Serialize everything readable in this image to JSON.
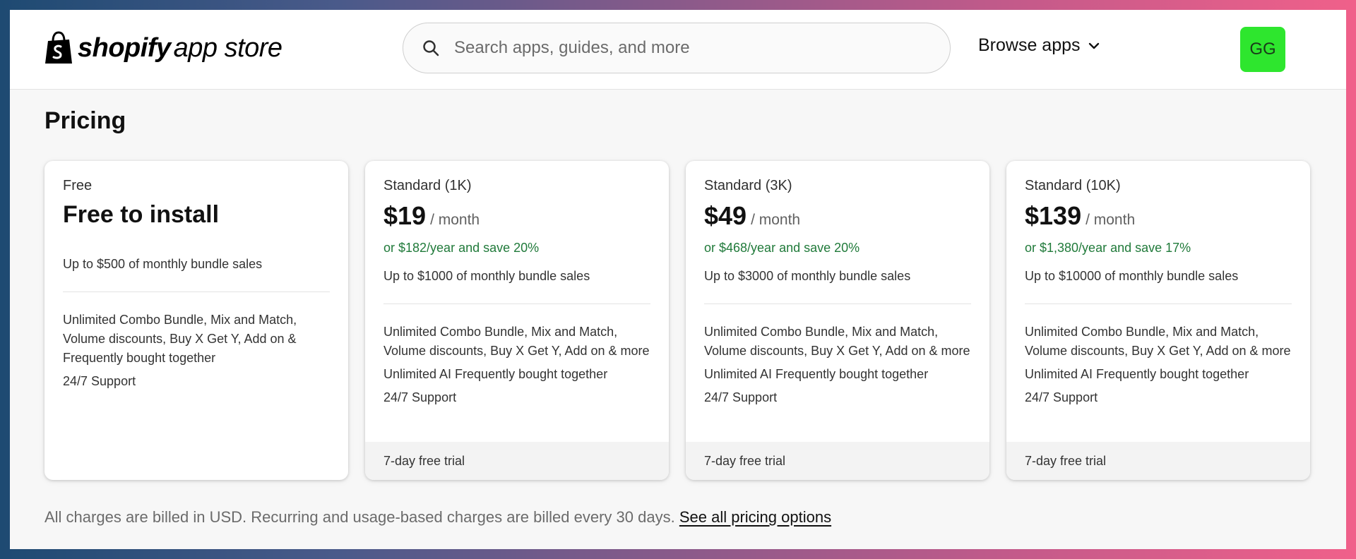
{
  "header": {
    "logo": {
      "bold": "shopify",
      "light": "app store"
    },
    "search": {
      "placeholder": "Search apps, guides, and more",
      "icon": "search-icon"
    },
    "browse_label": "Browse apps",
    "avatar_initials": "GG"
  },
  "colors": {
    "accent_green": "#207a3a",
    "avatar_bg": "#2ee62e"
  },
  "pricing": {
    "title": "Pricing",
    "plans": [
      {
        "name": "Free",
        "headline": "Free to install",
        "limit": "Up to $500 of monthly bundle sales",
        "features": [
          "Unlimited Combo Bundle, Mix and Match, Volume discounts, Buy X Get Y, Add on & Frequently bought together",
          "24/7 Support"
        ]
      },
      {
        "name": "Standard (1K)",
        "price": "$19",
        "period": "/ month",
        "annual": "or $182/year and save 20%",
        "limit": "Up to $1000 of monthly bundle sales",
        "features": [
          "Unlimited Combo Bundle, Mix and Match, Volume discounts, Buy X Get Y, Add on & more",
          "Unlimited AI Frequently bought together",
          "24/7 Support"
        ],
        "trial": "7-day free trial"
      },
      {
        "name": "Standard (3K)",
        "price": "$49",
        "period": "/ month",
        "annual": "or $468/year and save 20%",
        "limit": "Up to $3000 of monthly bundle sales",
        "features": [
          "Unlimited Combo Bundle, Mix and Match, Volume discounts, Buy X Get Y, Add on & more",
          "Unlimited AI Frequently bought together",
          "24/7 Support"
        ],
        "trial": "7-day free trial"
      },
      {
        "name": "Standard (10K)",
        "price": "$139",
        "period": "/ month",
        "annual": "or $1,380/year and save 17%",
        "limit": "Up to $10000 of monthly bundle sales",
        "features": [
          "Unlimited Combo Bundle, Mix and Match, Volume discounts, Buy X Get Y, Add on & more",
          "Unlimited AI Frequently bought together",
          "24/7 Support"
        ],
        "trial": "7-day free trial"
      }
    ],
    "footer_text": "All charges are billed in USD. Recurring and usage-based charges are billed every 30 days.",
    "footer_link": "See all pricing options"
  }
}
